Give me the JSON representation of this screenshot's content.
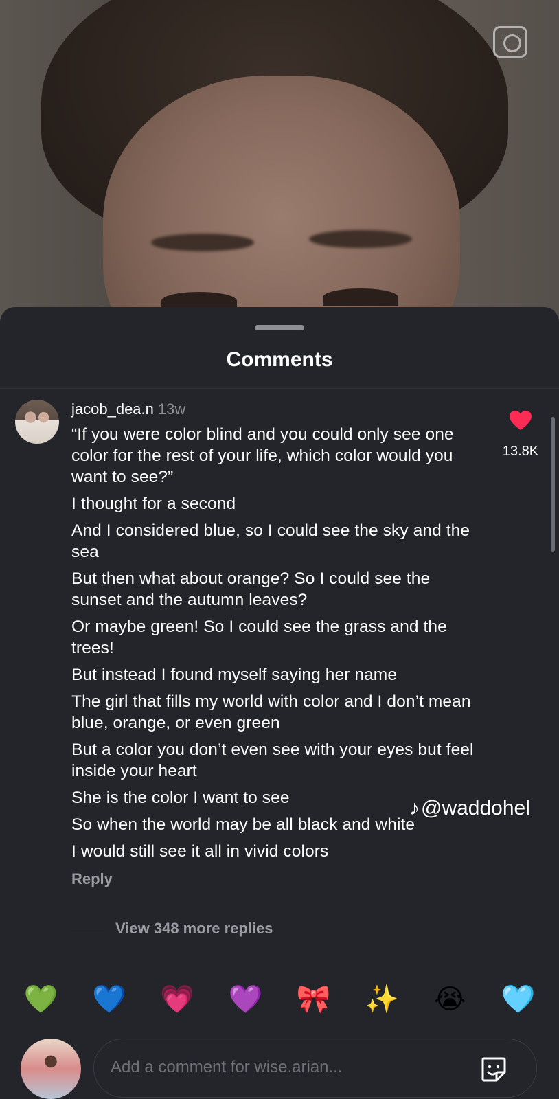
{
  "sheet": {
    "title": "Comments"
  },
  "comment": {
    "username": "jacob_dea.n",
    "timestamp": "13w",
    "lines": [
      "“If you were color blind and you could only see one color for the rest of your life, which color would you want to see?”",
      "I thought for a second",
      "And I considered blue, so I could see the sky and the sea",
      "But then what about orange? So I could see the sunset and the autumn leaves?",
      "Or maybe green! So I could see the grass and the trees!",
      "But instead I found myself saying her name",
      "The girl that fills my world with color and I don’t mean blue, orange, or even green",
      "But a color you don’t even see with your eyes but feel inside your heart",
      "She is the color I want to see",
      "So when the world may be all black and white",
      "I would still see it all in vivid colors"
    ],
    "reply_label": "Reply",
    "like_count": "13.8K",
    "view_replies_label": "View 348 more replies"
  },
  "watermark": {
    "handle": "@waddohel"
  },
  "emoji_bar": {
    "emojis": [
      "💚",
      "💙",
      "💗",
      "💜",
      "🎀",
      "✨",
      "😭",
      "🩵"
    ]
  },
  "composer": {
    "placeholder": "Add a comment for wise.arian..."
  },
  "colors": {
    "sheet_bg": "#23252b",
    "like_heart": "#fe2c55",
    "muted_text": "#9a9ca3"
  }
}
